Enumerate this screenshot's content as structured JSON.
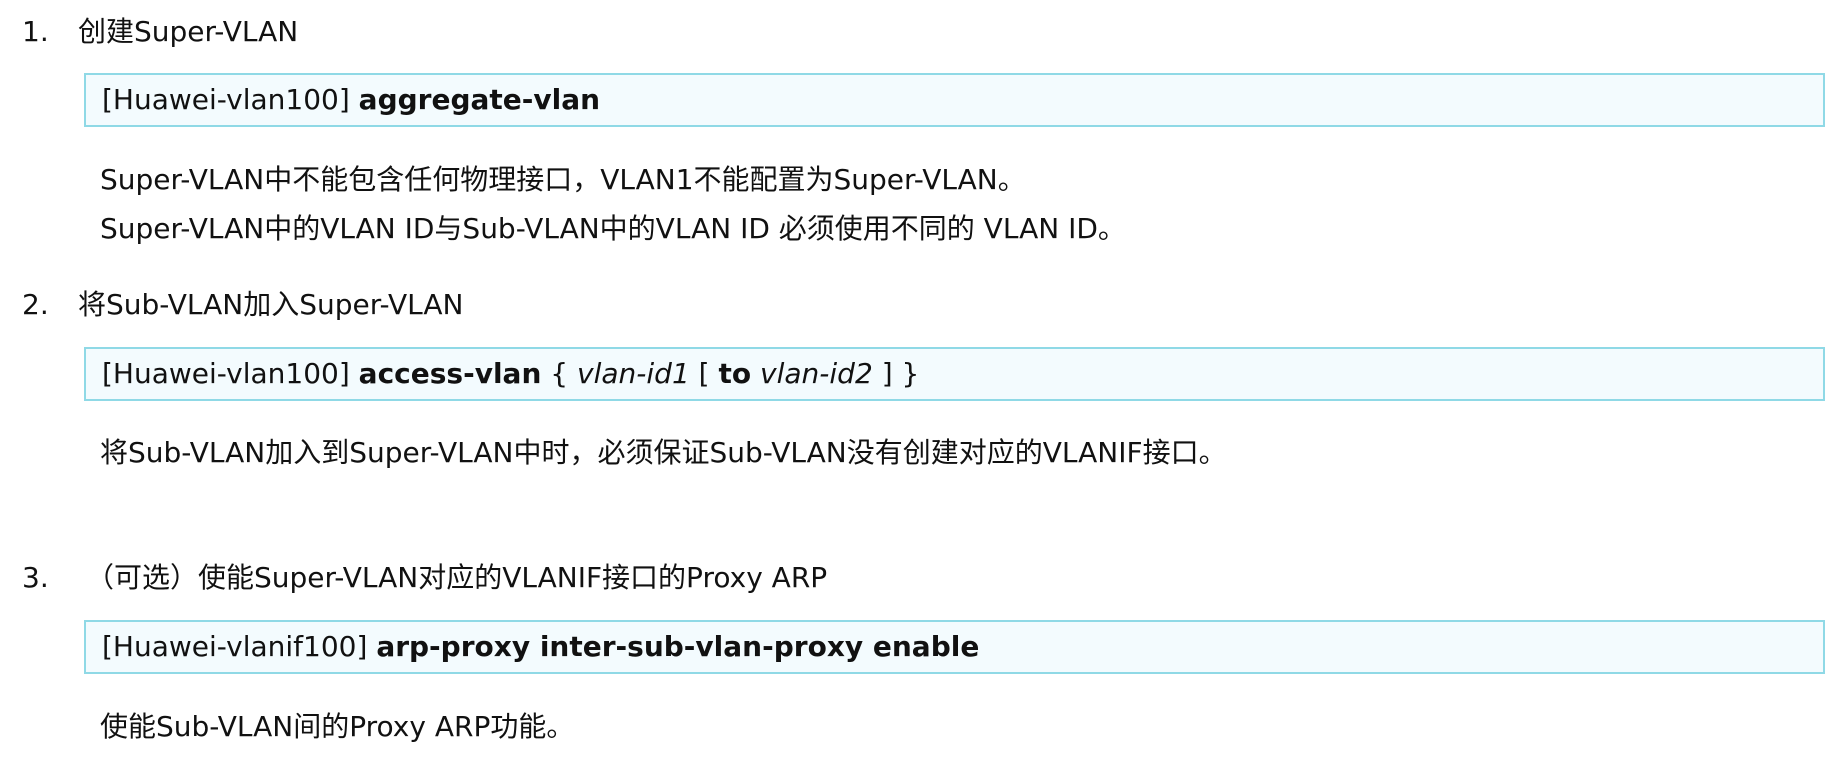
{
  "steps": [
    {
      "number": "1.",
      "title": "创建Super-VLAN",
      "command": {
        "prompt": "[Huawei-vlan100]",
        "keyword": "aggregate-vlan"
      },
      "notes": [
        "Super-VLAN中不能包含任何物理接口，VLAN1不能配置为Super-VLAN。",
        "Super-VLAN中的VLAN ID与Sub-VLAN中的VLAN ID 必须使用不同的 VLAN ID。"
      ]
    },
    {
      "number": "2.",
      "title": "将Sub-VLAN加入Super-VLAN",
      "command": {
        "prompt": "[Huawei-vlan100]",
        "keyword": "access-vlan",
        "brace_open": "{",
        "param1": "vlan-id1",
        "bracket_open": "[",
        "to": "to",
        "param2": "vlan-id2",
        "bracket_close": "]",
        "brace_close": "}"
      },
      "notes": [
        "将Sub-VLAN加入到Super-VLAN中时，必须保证Sub-VLAN没有创建对应的VLANIF接口。"
      ]
    },
    {
      "number": "3.",
      "title": "（可选）使能Super-VLAN对应的VLANIF接口的Proxy ARP",
      "command": {
        "prompt": "[Huawei-vlanif100]",
        "keyword": "arp-proxy inter-sub-vlan-proxy enable"
      },
      "notes": [
        "使能Sub-VLAN间的Proxy ARP功能。"
      ]
    }
  ],
  "colors": {
    "box_border": "#8fd9e6",
    "box_fill": "#f3fbfe",
    "text": "#111111"
  }
}
